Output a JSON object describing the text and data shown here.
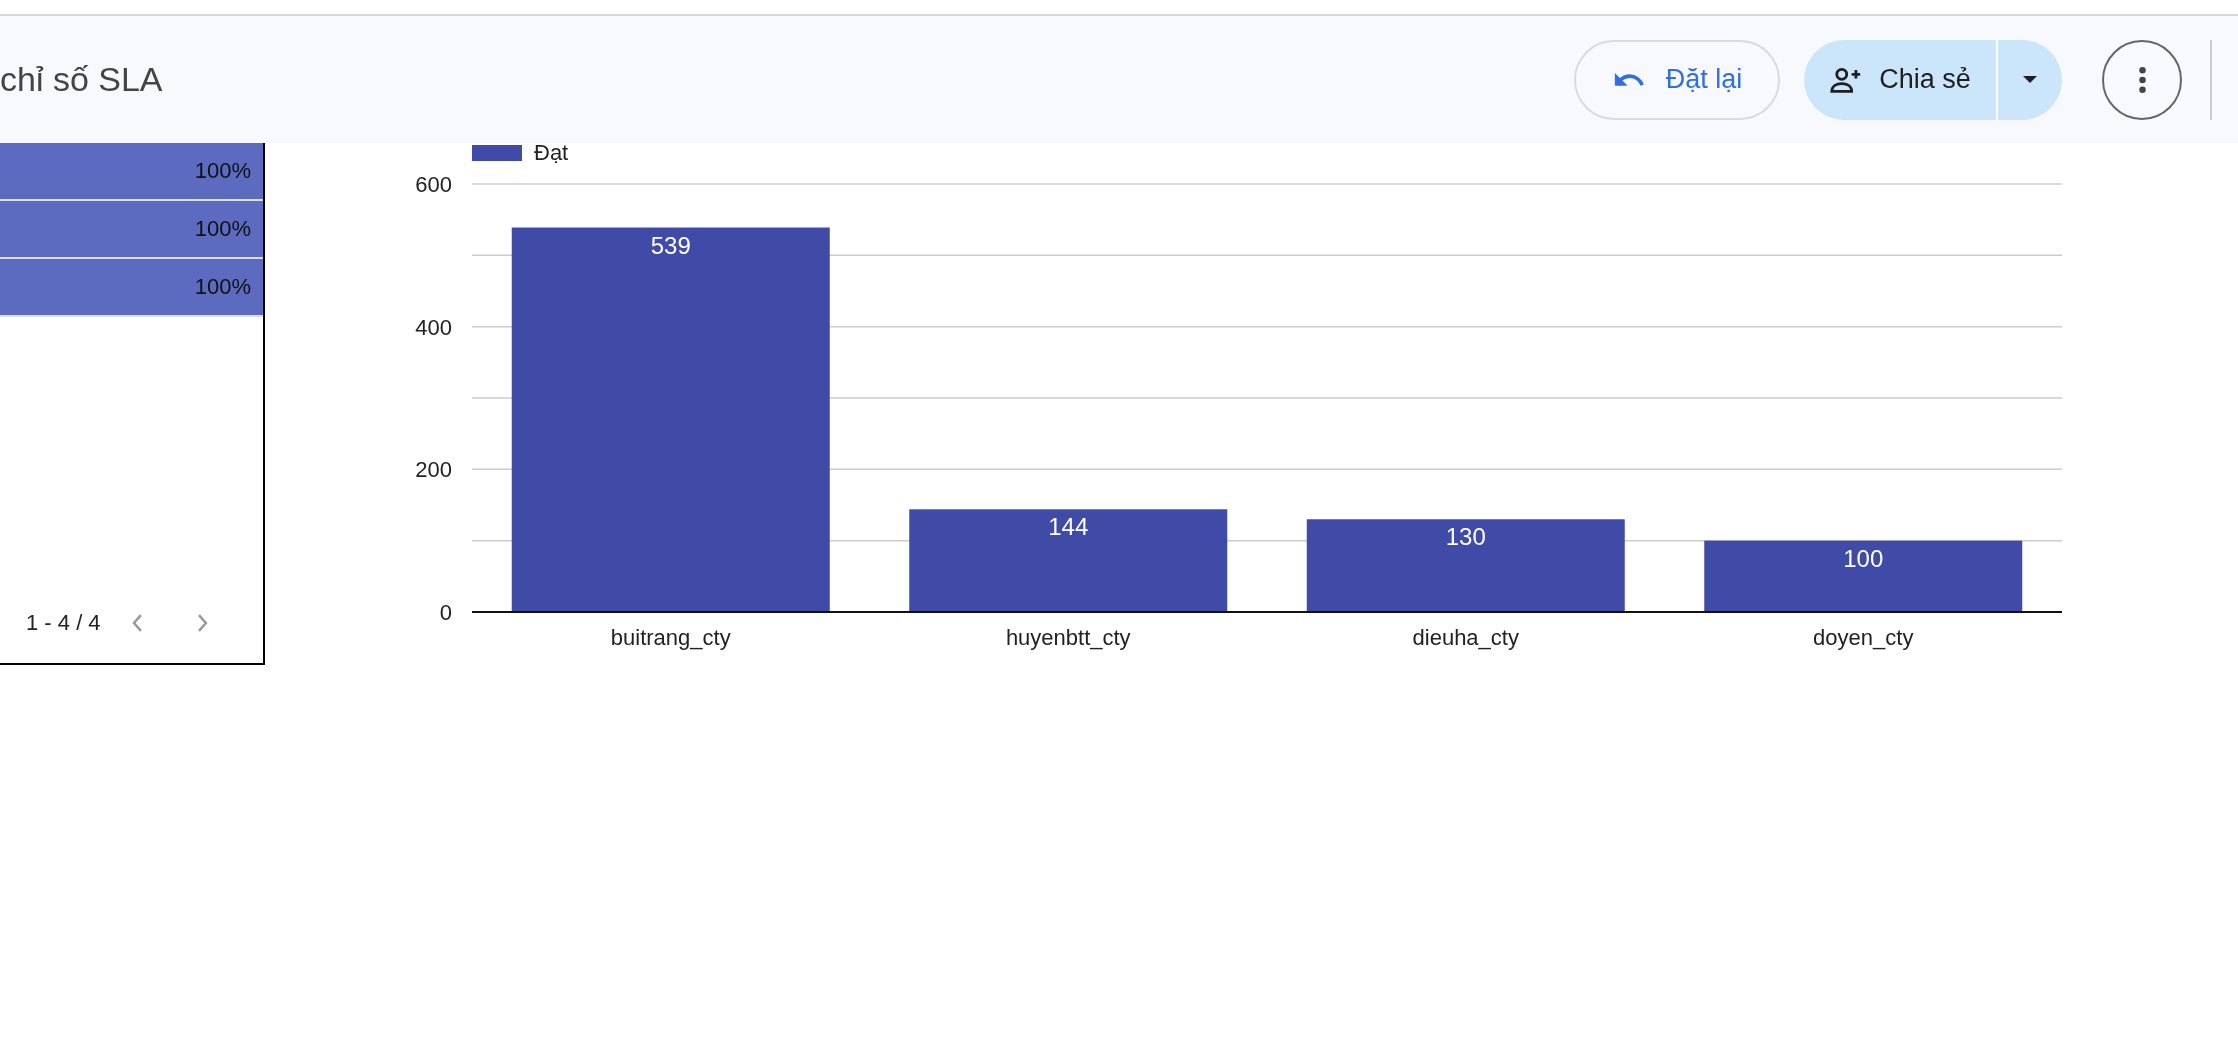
{
  "header": {
    "title": "chỉ số SLA",
    "reset_button": "Đặt lại",
    "share_button": "Chia sẻ"
  },
  "table": {
    "rows": [
      {
        "value": "100%"
      },
      {
        "value": "100%"
      },
      {
        "value": "100%"
      }
    ],
    "pagination": "1 - 4 / 4"
  },
  "chart": {
    "chart_data": {
      "type": "bar",
      "categories": [
        "buitrang_cty",
        "huyenbtt_cty",
        "dieuha_cty",
        "doyen_cty"
      ],
      "series": [
        {
          "name": "Đạt",
          "color": "#3f4ba6",
          "values": [
            539,
            144,
            130,
            100
          ]
        }
      ],
      "ylim": [
        0,
        600
      ],
      "yticks": [
        0,
        200,
        400,
        600
      ],
      "data_labels": true
    }
  }
}
